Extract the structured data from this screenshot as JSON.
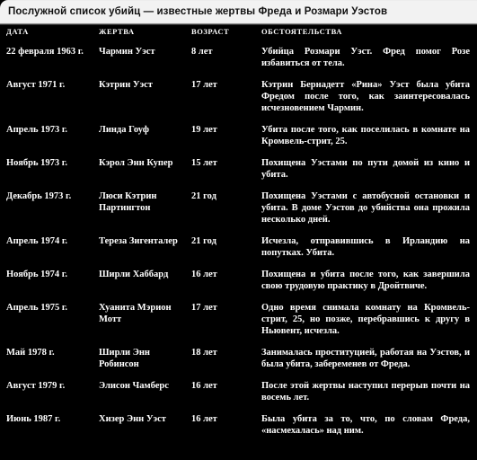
{
  "window": {
    "title": "Послужной список убийц — известные жертвы Фреда и Розмари Уэстов",
    "background_color": "#000000",
    "text_color": "#ffffff",
    "titlebar_color": "#f0f0f0"
  },
  "table": {
    "columns": [
      {
        "key": "date",
        "label": "ДАТА"
      },
      {
        "key": "victim",
        "label": "ЖЕРТВА"
      },
      {
        "key": "age",
        "label": "ВОЗРАСТ"
      },
      {
        "key": "circumstances",
        "label": "ОБСТОЯТЕЛЬСТВА"
      }
    ],
    "rows": [
      {
        "date": "22 февраля 1963 г.",
        "victim": "Чармин Уэст",
        "age": "8 лет",
        "circumstances": "Убийца Розмари Уэст. Фред помог Розе избавиться от тела."
      },
      {
        "date": "Август 1971 г.",
        "victim": "Кэтрин Уэст",
        "age": "17 лет",
        "circumstances": "Кэтрин Бернадетт «Рина» Уэст была убита Фредом после того, как заинтересовалась исчезновением Чармин."
      },
      {
        "date": "Апрель 1973 г.",
        "victim": "Линда Гоуф",
        "age": "19 лет",
        "circumstances": "Убита после того, как поселилась в комнате на Кромвель-стрит, 25."
      },
      {
        "date": "Ноябрь 1973 г.",
        "victim": "Кэрол Энн Купер",
        "age": "15 лет",
        "circumstances": "Похищена Уэстами по пути домой из кино и убита."
      },
      {
        "date": "Декабрь 1973 г.",
        "victim": "Люси Кэтрин Партингтон",
        "age": "21 год",
        "circumstances": "Похищена Уэстами с автобусной остановки и убита. В доме Уэстов до убийства она прожила несколько дней."
      },
      {
        "date": "Апрель 1974 г.",
        "victim": "Тереза Зигенталер",
        "age": "21 год",
        "circumstances": "Исчезла, отправившись в Ирландию на попутках. Убита."
      },
      {
        "date": "Ноябрь 1974 г.",
        "victim": "Ширли Хаббард",
        "age": "16 лет",
        "circumstances": "Похищена и убита после того, как завершила свою трудовую практику в Дройтвиче."
      },
      {
        "date": "Апрель 1975 г.",
        "victim": "Хуанита Мэрион Мотт",
        "age": "17 лет",
        "circumstances": "Одно время снимала комнату на Кромвель-стрит, 25, но позже, перебравшись к другу в Ньювент, исчезла."
      },
      {
        "date": "Май 1978 г.",
        "victim": "Ширли Энн Робинсон",
        "age": "18 лет",
        "circumstances": "Занималась проституцией, работая на Уэстов, и была убита, забеременев от Фреда."
      },
      {
        "date": "Август 1979 г.",
        "victim": "Элисон Чамберс",
        "age": "16 лет",
        "circumstances": "После этой жертвы наступил перерыв почти на восемь лет."
      },
      {
        "date": "Июнь 1987 г.",
        "victim": "Хизер Энн Уэст",
        "age": "16 лет",
        "circumstances": "Была убита за то, что, по словам Фреда, «насмехалась» над ним."
      }
    ]
  }
}
